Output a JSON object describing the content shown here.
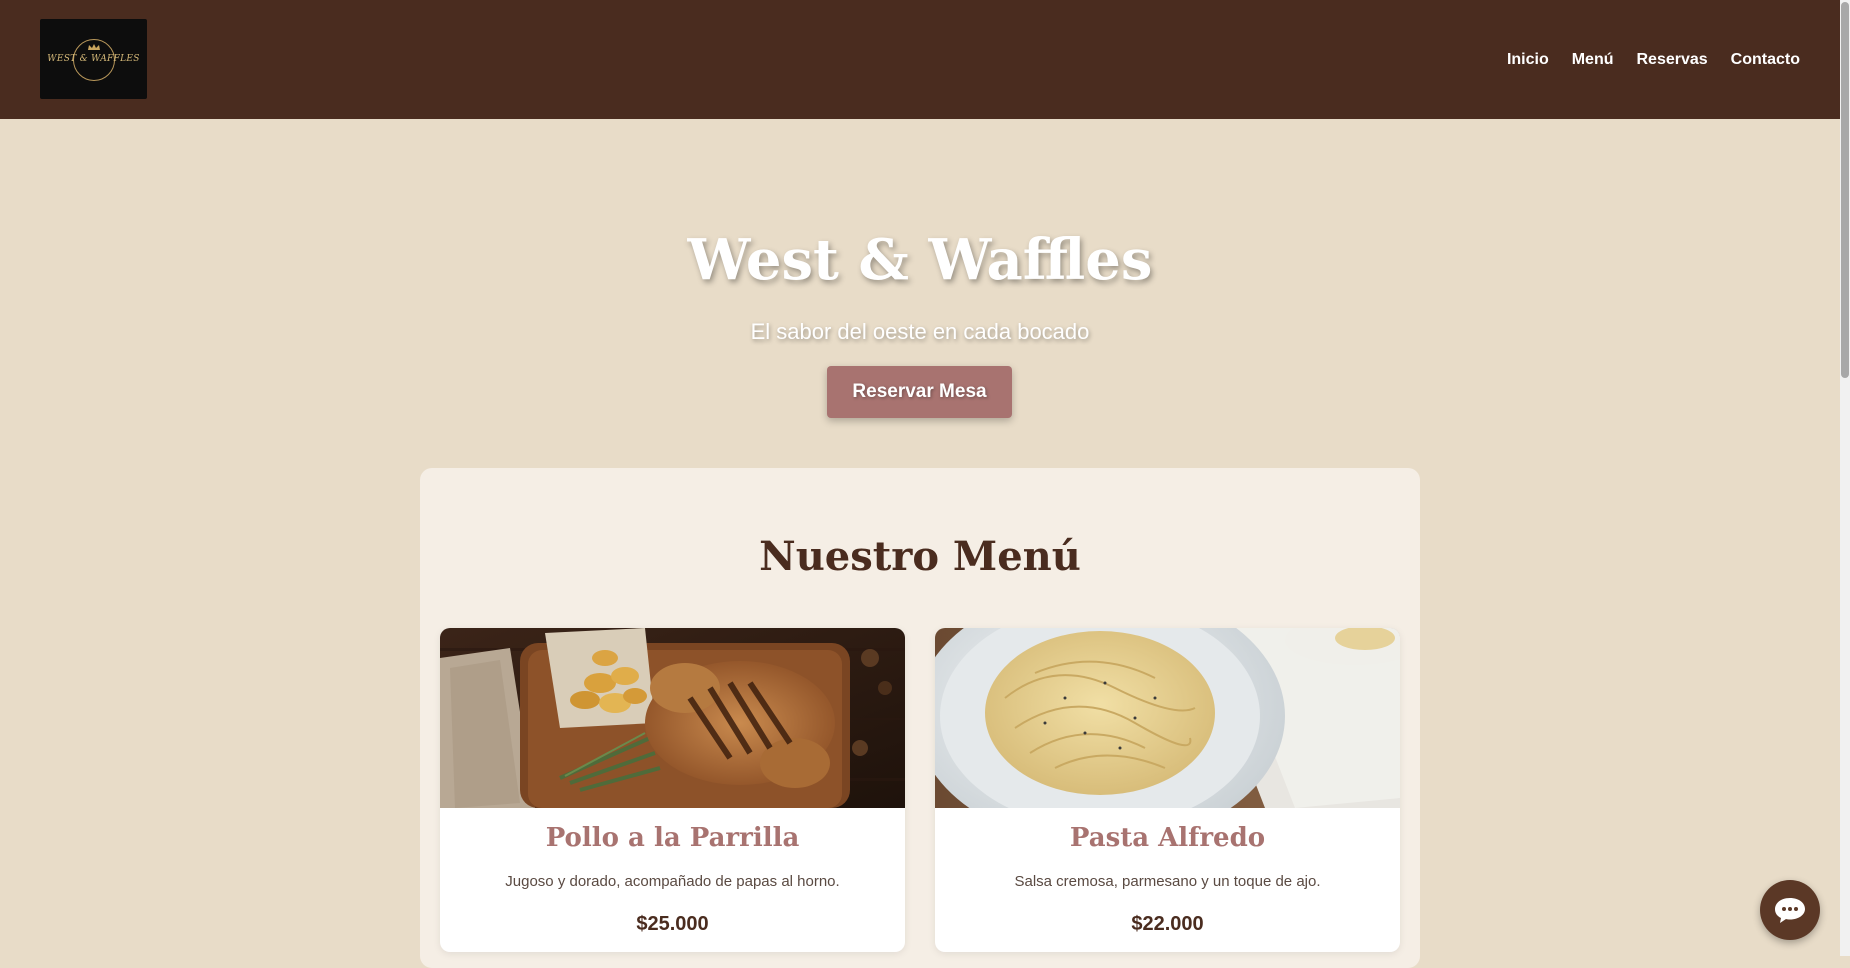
{
  "header": {
    "logo_text": "WEST & WAFFLES",
    "nav": [
      {
        "label": "Inicio"
      },
      {
        "label": "Menú"
      },
      {
        "label": "Reservas"
      },
      {
        "label": "Contacto"
      }
    ]
  },
  "hero": {
    "title": "West & Waffles",
    "subtitle": "El sabor del oeste en cada bocado",
    "cta_label": "Reservar Mesa"
  },
  "menu": {
    "title": "Nuestro Menú",
    "items": [
      {
        "name": "Pollo a la Parrilla",
        "description": "Jugoso y dorado, acompañado de papas al horno.",
        "price": "$25.000"
      },
      {
        "name": "Pasta Alfredo",
        "description": "Salsa cremosa, parmesano y un toque de ajo.",
        "price": "$22.000"
      }
    ]
  },
  "chat": {
    "icon": "chat-bubble-icon"
  },
  "colors": {
    "header_bg": "#4a2c1f",
    "page_bg": "#e8dcc8",
    "accent": "#a87370",
    "menu_bg": "#f5eee5"
  }
}
